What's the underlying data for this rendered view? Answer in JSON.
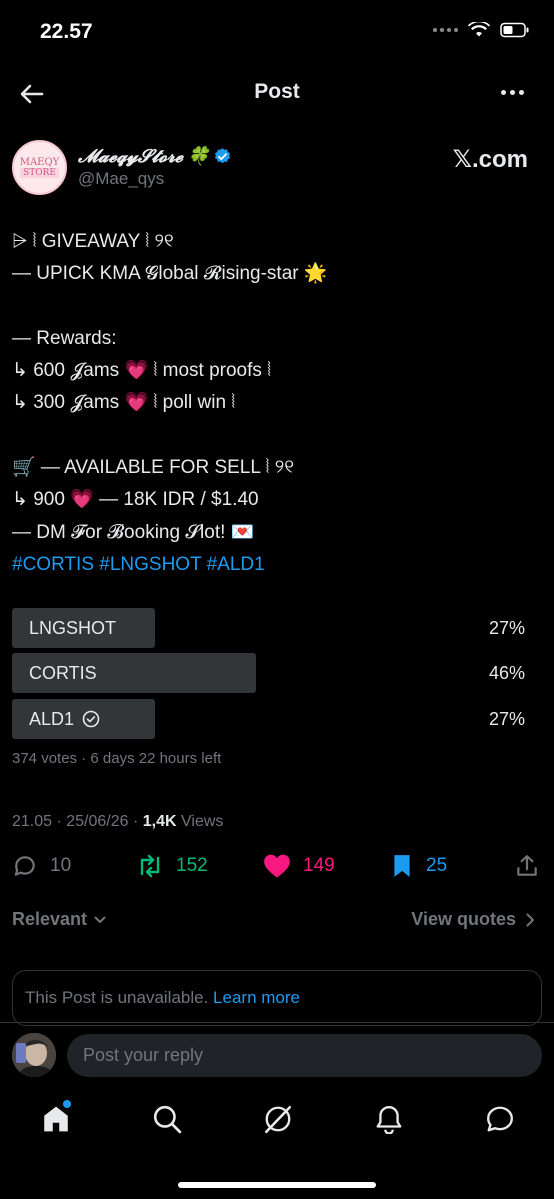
{
  "status_bar": {
    "time": "22.57"
  },
  "header": {
    "title": "Post"
  },
  "author": {
    "avatar_text_1": "MAEQY",
    "avatar_text_2": "STORE",
    "display_name": "𝓜𝓪𝓮𝓺𝔂𝓢𝓽𝓸𝓻𝓮",
    "name_emoji": "🍀",
    "handle": "@Mae_qys",
    "brand": "𝕏.com"
  },
  "post": {
    "lines": [
      "⩥ ⦚ GIVEAWAY ⦚ ୨୧",
      "— UPICK KMA 𝓖lobal 𝓡ising-star 🌟",
      "",
      "— Rewards:",
      "↳ 600 𝓙ams 💗  ⦚ most proofs ⦚",
      "↳ 300 𝓙ams 💗  ⦚ poll win ⦚",
      "",
      "🛒 — AVAILABLE FOR SELL ⦚ ୨୧",
      "↳ 900 💗 — 18K IDR / $1.40",
      "—  DM 𝓕or 𝓑ooking 𝓢lot! 💌"
    ],
    "hashtags": "#CORTIS #LNGSHOT #ALD1"
  },
  "poll": {
    "options": [
      {
        "label": "LNGSHOT",
        "percent": "27%",
        "value": 27,
        "voted": false
      },
      {
        "label": "CORTIS",
        "percent": "46%",
        "value": 46,
        "voted": false
      },
      {
        "label": "ALD1",
        "percent": "27%",
        "value": 27,
        "voted": true
      }
    ],
    "meta": "374 votes · 6 days 22 hours left"
  },
  "timestamp": {
    "time": "21.05 · 25/06/26 · ",
    "views": "1,4K",
    "views_label": " Views"
  },
  "actions": {
    "replies": "10",
    "retweets": "152",
    "likes": "149",
    "bookmarks": "25"
  },
  "sort": {
    "label": "Relevant",
    "quotes": "View quotes"
  },
  "unavailable": {
    "text": "This Post is unavailable. ",
    "link": "Learn more"
  },
  "reply": {
    "placeholder": "Post your reply"
  },
  "colors": {
    "accent": "#1d9bf0",
    "retweet": "#00ba7c",
    "like": "#f91880",
    "muted": "#71767b"
  }
}
